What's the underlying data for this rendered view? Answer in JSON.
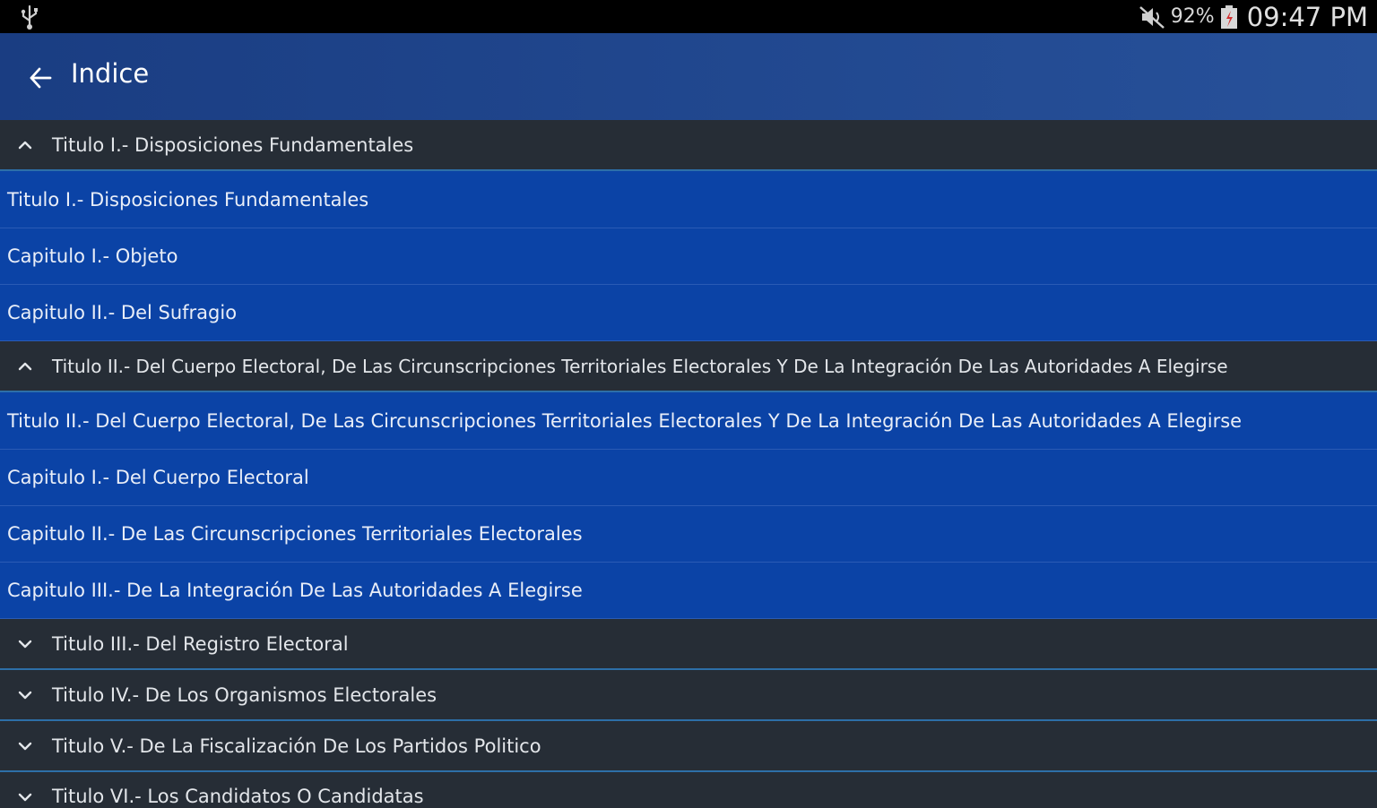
{
  "status_bar": {
    "battery_percent": "92%",
    "time": "09:47 PM",
    "icons": [
      "usb-icon",
      "mute-icon",
      "battery-icon"
    ]
  },
  "app_bar": {
    "title": "Indice",
    "back_icon": "arrow-left-icon"
  },
  "groups": [
    {
      "title": "Titulo I.- Disposiciones Fundamentales",
      "expanded": true,
      "items": [
        "Titulo I.- Disposiciones Fundamentales",
        "Capitulo I.- Objeto",
        "Capitulo II.- Del Sufragio"
      ]
    },
    {
      "title": "Titulo II.- Del Cuerpo Electoral, De Las Circunscripciones Territoriales Electorales Y De La Integración De Las Autoridades A Elegirse",
      "expanded": true,
      "items": [
        "Titulo II.- Del Cuerpo Electoral, De Las Circunscripciones Territoriales Electorales Y De La Integración De Las Autoridades A Elegirse",
        "Capitulo I.- Del Cuerpo Electoral",
        "Capitulo II.- De Las Circunscripciones Territoriales Electorales",
        "Capitulo III.- De La Integración De Las Autoridades A Elegirse"
      ]
    },
    {
      "title": "Titulo III.- Del Registro Electoral",
      "expanded": false,
      "items": []
    },
    {
      "title": "Titulo IV.- De Los Organismos Electorales",
      "expanded": false,
      "items": []
    },
    {
      "title": "Titulo V.- De La Fiscalización De Los Partidos Politico",
      "expanded": false,
      "items": []
    },
    {
      "title": "Titulo VI.- Los Candidatos O Candidatas",
      "expanded": false,
      "items": []
    }
  ],
  "colors": {
    "status_bar_bg": "#000000",
    "app_bar_start": "#1a3d82",
    "app_bar_end": "#27519a",
    "group_header_bg": "#262d36",
    "group_divider": "#2d6fa8",
    "child_item_bg": "#0b43a6"
  }
}
